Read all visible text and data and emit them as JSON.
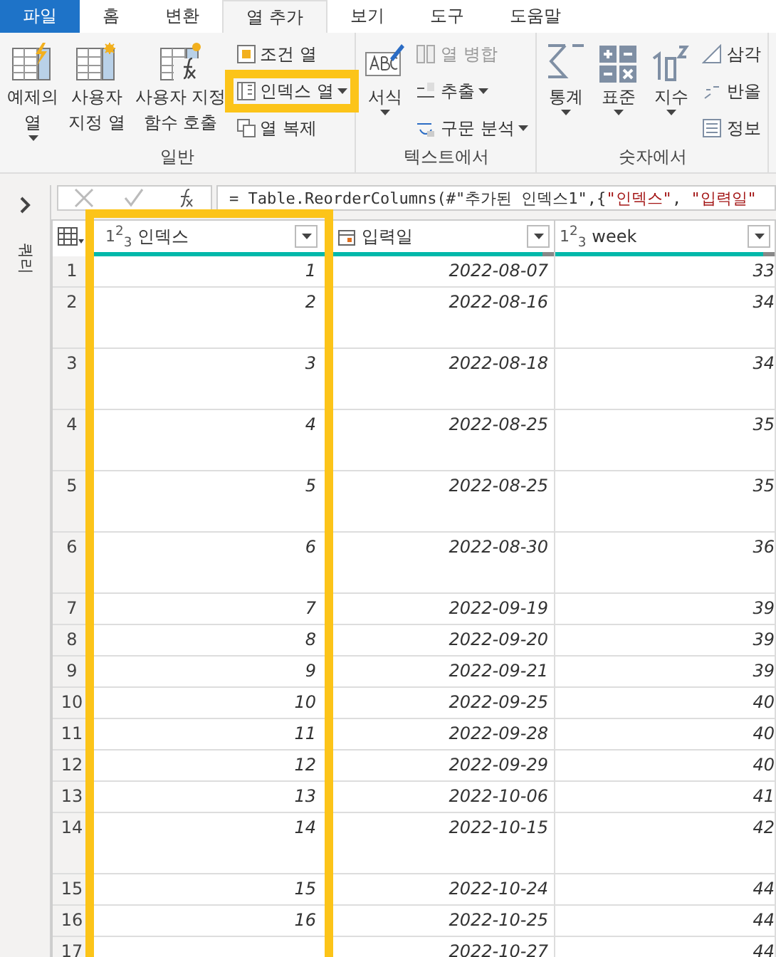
{
  "menu_tabs": [
    {
      "label": "파일",
      "kind": "file",
      "selected": false
    },
    {
      "label": "홈",
      "kind": "tab",
      "selected": false
    },
    {
      "label": "변환",
      "kind": "tab",
      "selected": false
    },
    {
      "label": "열 추가",
      "kind": "tab",
      "selected": true
    },
    {
      "label": "보기",
      "kind": "tab",
      "selected": false
    },
    {
      "label": "도구",
      "kind": "tab",
      "selected": false
    },
    {
      "label": "도움말",
      "kind": "tab",
      "selected": false
    }
  ],
  "ribbon_groups": [
    {
      "label": "일반",
      "items": [
        {
          "kind": "large",
          "label": "예제의\n열",
          "has_menu": true,
          "disabled": false
        },
        {
          "kind": "large",
          "label": "사용자\n지정 열",
          "has_menu": false,
          "disabled": false
        },
        {
          "kind": "large",
          "label": "사용자 지정\n함수 호출",
          "has_menu": false,
          "disabled": false
        },
        {
          "kind": "stack",
          "items": [
            {
              "label": "조건 열",
              "has_menu": false,
              "disabled": false,
              "highlighted": false
            },
            {
              "label": "인덱스 열",
              "has_menu": true,
              "disabled": false,
              "highlighted": true
            },
            {
              "label": "열 복제",
              "has_menu": false,
              "disabled": false,
              "highlighted": false
            }
          ]
        }
      ]
    },
    {
      "label": "텍스트에서",
      "items": [
        {
          "kind": "large",
          "label": "서식",
          "has_menu": true,
          "disabled": false
        },
        {
          "kind": "stack",
          "items": [
            {
              "label": "열 병합",
              "has_menu": false,
              "disabled": true,
              "highlighted": false
            },
            {
              "label": "추출",
              "has_menu": true,
              "disabled": false,
              "highlighted": false
            },
            {
              "label": "구문 분석",
              "has_menu": true,
              "disabled": false,
              "highlighted": false
            }
          ]
        }
      ]
    },
    {
      "label": "숫자에서",
      "items": [
        {
          "kind": "large",
          "label": "통계",
          "has_menu": true,
          "disabled": false
        },
        {
          "kind": "large",
          "label": "표준",
          "has_menu": true,
          "disabled": false
        },
        {
          "kind": "large",
          "label": "지수",
          "has_menu": true,
          "disabled": false
        },
        {
          "kind": "stack",
          "items": [
            {
              "label": "삼각",
              "has_menu": false,
              "disabled": false,
              "highlighted": false
            },
            {
              "label": "반올",
              "has_menu": false,
              "disabled": false,
              "highlighted": false
            },
            {
              "label": "정보",
              "has_menu": false,
              "disabled": false,
              "highlighted": false
            }
          ]
        }
      ]
    }
  ],
  "queries_pane": {
    "label": "쿼리"
  },
  "formula_bar": {
    "parts": [
      {
        "kind": "code",
        "text": "= Table.ReorderColumns(#\"추가된 인덱스1\",{"
      },
      {
        "kind": "string",
        "text": "\"인덱스\""
      },
      {
        "kind": "code",
        "text": ", "
      },
      {
        "kind": "string",
        "text": "\"입력일\""
      }
    ]
  },
  "table": {
    "columns": [
      {
        "name": "인덱스",
        "kind": "number",
        "type_label": "1$^{2}$$_{3}$",
        "level": 1,
        "highlighted": true
      },
      {
        "name": "입력일",
        "kind": "date",
        "level": 0.95,
        "highlighted": false
      },
      {
        "name": "week",
        "kind": "number",
        "type_label": "1$^{2}$$_{3}$",
        "level": 0.95,
        "highlighted": false
      }
    ],
    "rows": [
      {
        "number": "1",
        "cells": [
          "1",
          "2022-08-07",
          "33"
        ],
        "tall": false
      },
      {
        "number": "2",
        "cells": [
          "2",
          "2022-08-16",
          "34"
        ],
        "tall": true
      },
      {
        "number": "3",
        "cells": [
          "3",
          "2022-08-18",
          "34"
        ],
        "tall": true
      },
      {
        "number": "4",
        "cells": [
          "4",
          "2022-08-25",
          "35"
        ],
        "tall": true
      },
      {
        "number": "5",
        "cells": [
          "5",
          "2022-08-25",
          "35"
        ],
        "tall": true
      },
      {
        "number": "6",
        "cells": [
          "6",
          "2022-08-30",
          "36"
        ],
        "tall": true
      },
      {
        "number": "7",
        "cells": [
          "7",
          "2022-09-19",
          "39"
        ],
        "tall": false
      },
      {
        "number": "8",
        "cells": [
          "8",
          "2022-09-20",
          "39"
        ],
        "tall": false
      },
      {
        "number": "9",
        "cells": [
          "9",
          "2022-09-21",
          "39"
        ],
        "tall": false
      },
      {
        "number": "10",
        "cells": [
          "10",
          "2022-09-25",
          "40"
        ],
        "tall": false
      },
      {
        "number": "11",
        "cells": [
          "11",
          "2022-09-28",
          "40"
        ],
        "tall": false
      },
      {
        "number": "12",
        "cells": [
          "12",
          "2022-09-29",
          "40"
        ],
        "tall": false
      },
      {
        "number": "13",
        "cells": [
          "13",
          "2022-10-06",
          "41"
        ],
        "tall": false
      },
      {
        "number": "14",
        "cells": [
          "14",
          "2022-10-15",
          "42"
        ],
        "tall": true
      },
      {
        "number": "15",
        "cells": [
          "15",
          "2022-10-24",
          "44"
        ],
        "tall": false
      },
      {
        "number": "16",
        "cells": [
          "16",
          "2022-10-25",
          "44"
        ],
        "tall": false
      },
      {
        "number": "17",
        "cells": [
          null,
          "2022-10-27",
          "44"
        ],
        "tall": false
      }
    ]
  }
}
